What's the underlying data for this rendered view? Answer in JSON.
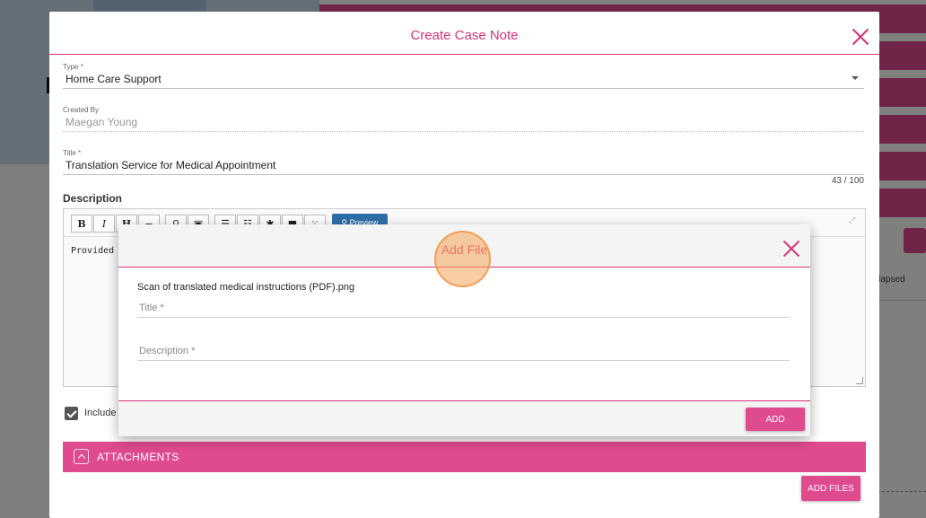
{
  "background": {
    "collapsed_label": "llapsed"
  },
  "dialog": {
    "title": "Create Case Note",
    "type": {
      "label": "Type *",
      "value": "Home Care Support"
    },
    "created_by": {
      "label": "Created By",
      "value": "Maegan Young"
    },
    "title_field": {
      "label": "Title *",
      "value": "Translation Service for Medical Appointment",
      "counter": "43 / 100"
    },
    "description": {
      "label": "Description",
      "toolbar": {
        "bold": "B",
        "italic": "I",
        "heading": "H",
        "preview": "Preview"
      },
      "text": "Provided "
    },
    "include_checkbox": {
      "label": "Include",
      "checked": true
    },
    "attachments": {
      "label": "ATTACHMENTS"
    },
    "add_files_label": "ADD FILES"
  },
  "modal": {
    "title": "Add File",
    "file_name": "Scan of translated medical instructions (PDF).png",
    "title_placeholder": "Title *",
    "description_placeholder": "Description *",
    "add_label": "ADD"
  },
  "colors": {
    "accent": "#e04a8f",
    "title": "#d6337a",
    "click_highlight": "#f5a65a"
  }
}
